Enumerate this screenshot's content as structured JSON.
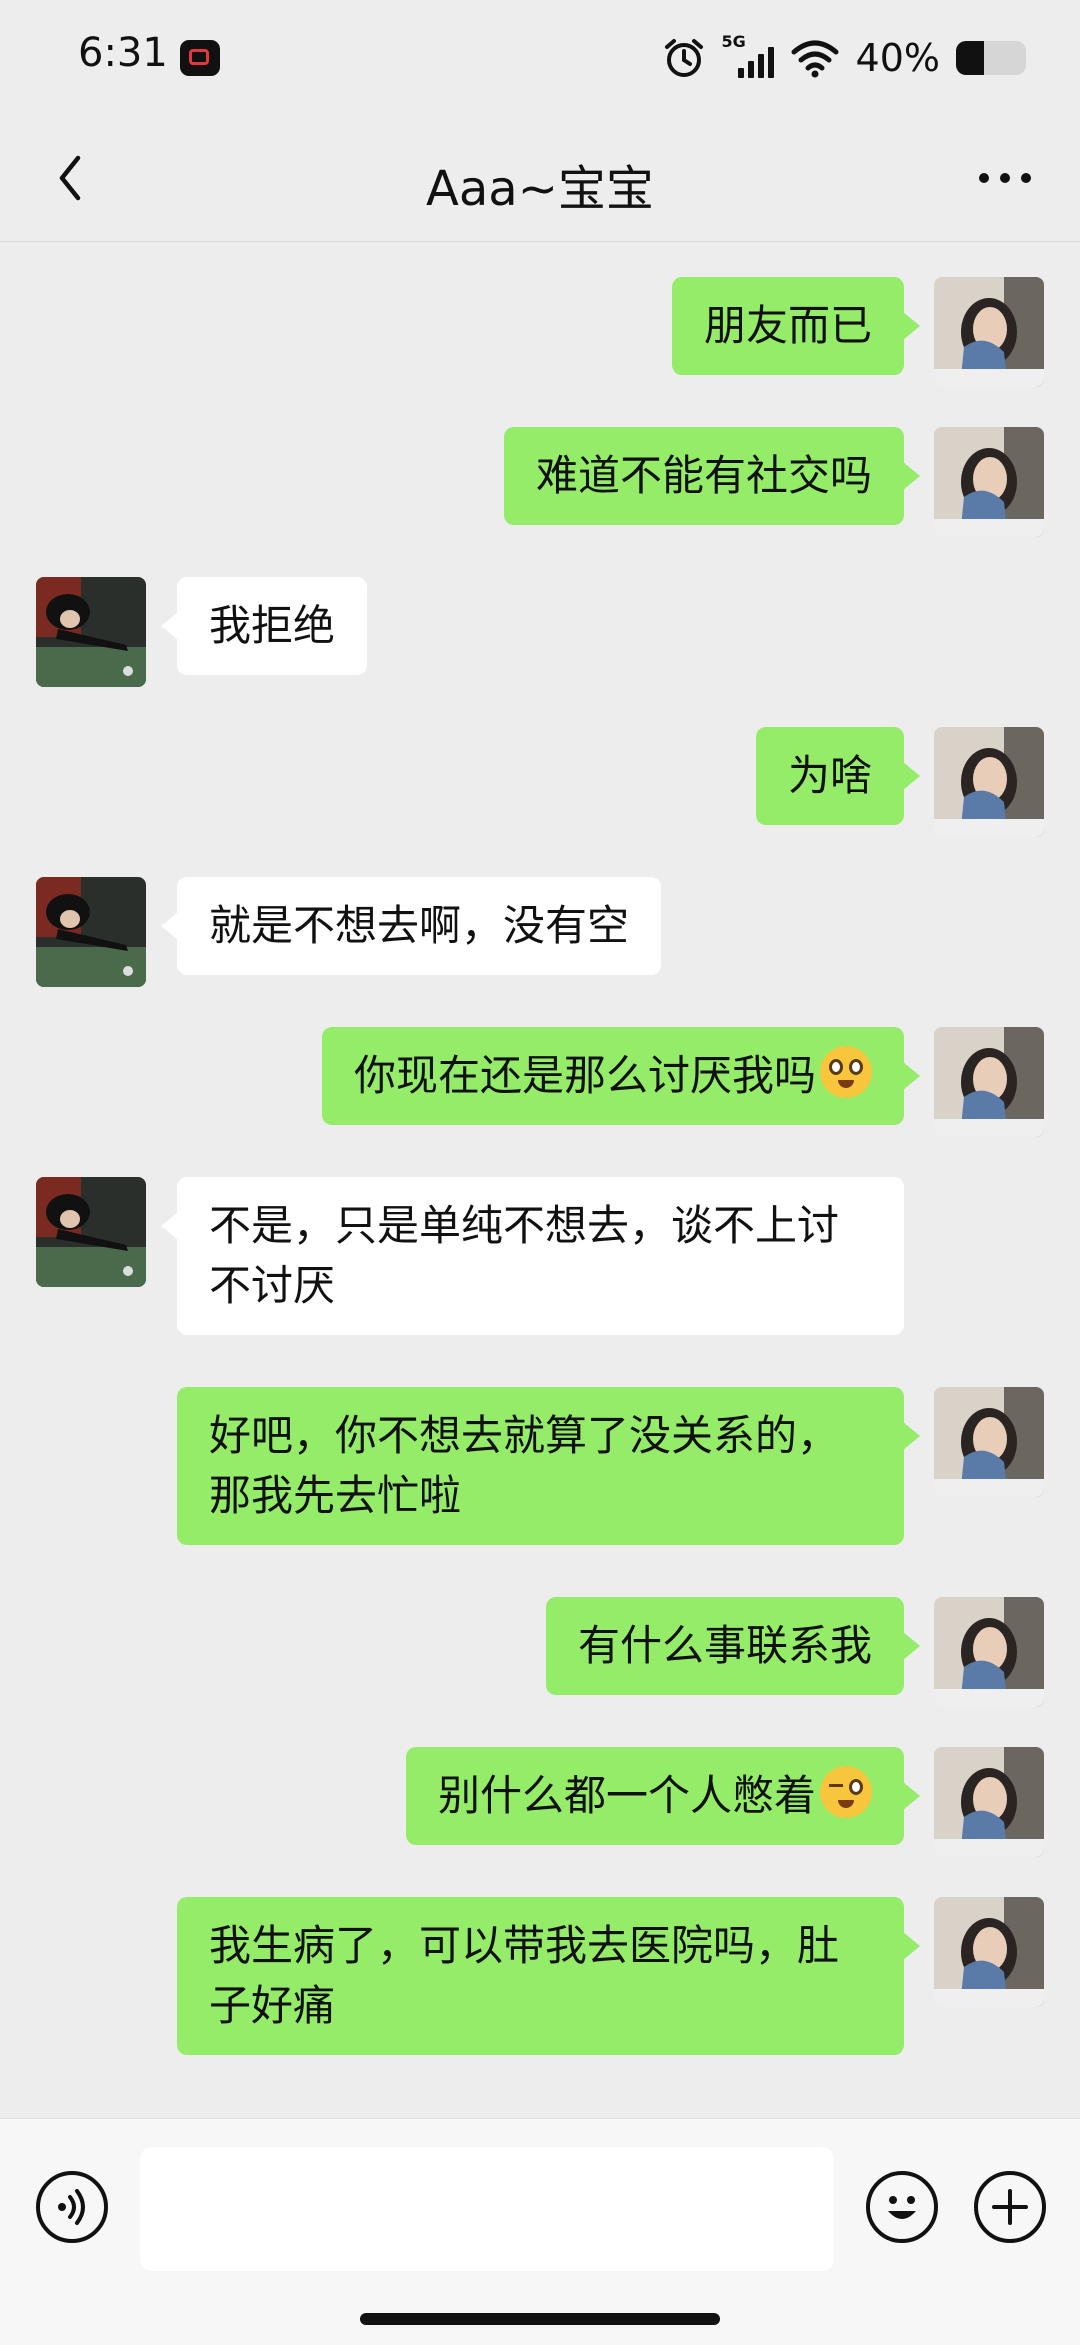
{
  "status_bar": {
    "time": "6:31",
    "network": "5G",
    "battery_percent": "40%",
    "battery_level": 0.4,
    "icons": [
      "screen-record-icon",
      "alarm-icon",
      "signal-icon",
      "wifi-icon",
      "battery-icon"
    ]
  },
  "header": {
    "title": "Aaa~宝宝",
    "back_icon": "chevron-left-icon",
    "more_icon": "more-icon"
  },
  "messages": [
    {
      "sender": "me",
      "text": "朋友而已"
    },
    {
      "sender": "me",
      "text": "难道不能有社交吗"
    },
    {
      "sender": "them",
      "text": "我拒绝"
    },
    {
      "sender": "me",
      "text": "为啥"
    },
    {
      "sender": "them",
      "text": "就是不想去啊，没有空"
    },
    {
      "sender": "me",
      "text": "你现在还是那么讨厌我吗",
      "emoji": "pleading-face-emoji"
    },
    {
      "sender": "them",
      "text": "不是，只是单纯不想去，谈不上讨不讨厌"
    },
    {
      "sender": "me",
      "text": "好吧，你不想去就算了没关系的，那我先去忙啦"
    },
    {
      "sender": "me",
      "text": "有什么事联系我"
    },
    {
      "sender": "me",
      "text": "别什么都一个人憋着",
      "emoji": "winking-face-emoji"
    },
    {
      "sender": "me",
      "text": "我生病了，可以带我去医院吗，肚子好痛"
    }
  ],
  "input_bar": {
    "voice_icon": "voice-icon",
    "input_value": "",
    "emoji_icon": "emoji-icon",
    "plus_icon": "plus-icon"
  },
  "colors": {
    "background": "#ededed",
    "my_bubble": "#95ec69",
    "their_bubble": "#ffffff"
  }
}
